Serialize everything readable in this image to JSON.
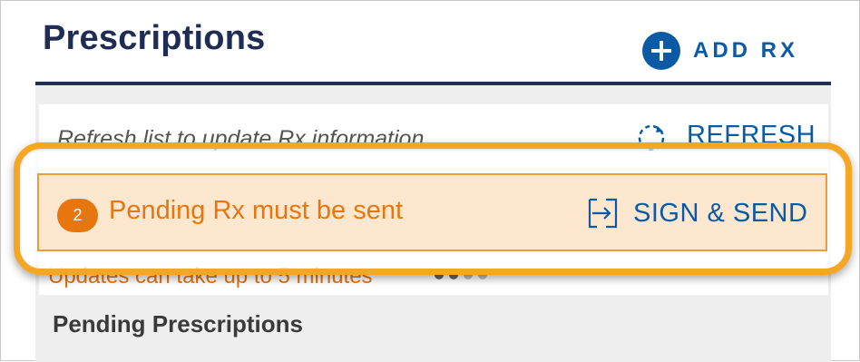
{
  "header": {
    "title": "Prescriptions",
    "add_rx_label": "ADD RX"
  },
  "refresh": {
    "message": "Refresh list to update Rx information",
    "button_label": "REFRESH"
  },
  "pending_banner": {
    "count": "2",
    "message": "Pending Rx must be sent",
    "action_label": "SIGN & SEND"
  },
  "status": {
    "updates_message": "Updates can take up to 5 minutes"
  },
  "sections": {
    "pending_heading": "Pending Prescriptions"
  },
  "icons": {
    "add": "plus-circle-icon",
    "refresh": "refresh-icon",
    "send": "sign-send-icon"
  },
  "colors": {
    "title": "#1f2d55",
    "accent_blue": "#0a5aa5",
    "pending_orange": "#e7760f",
    "banner_fill": "#fde8cf",
    "highlight_ring": "#f5a623"
  }
}
